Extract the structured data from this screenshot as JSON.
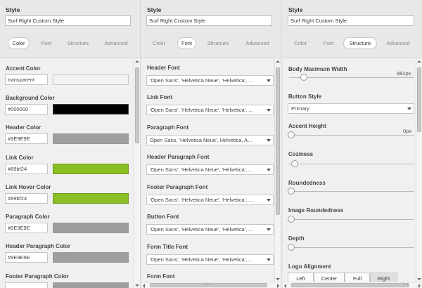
{
  "panels": [
    {
      "style_label": "Style",
      "style_value": "Surf Right Custom Style",
      "tabs": [
        "Color",
        "Font",
        "Structure",
        "Advanced"
      ],
      "active_tab": "Color",
      "color_fields": [
        {
          "label": "Accent Color",
          "value": "transparent",
          "swatch": "#f2f2f2"
        },
        {
          "label": "Background Color",
          "value": "#000000",
          "swatch": "#000000"
        },
        {
          "label": "Header Color",
          "value": "#9E9E9E",
          "swatch": "#9e9e9e"
        },
        {
          "label": "Link Color",
          "value": "#89bf24",
          "swatch": "#89bf24"
        },
        {
          "label": "Link Hover Color",
          "value": "#89bf24",
          "swatch": "#89bf24"
        },
        {
          "label": "Paragraph Color",
          "value": "#9E9E9E",
          "swatch": "#9e9e9e"
        },
        {
          "label": "Header Paragraph Color",
          "value": "#9E9E9E",
          "swatch": "#9e9e9e"
        },
        {
          "label": "Footer Paragraph Color",
          "value": "",
          "swatch": "#9e9e9e"
        }
      ]
    },
    {
      "style_label": "Style",
      "style_value": "Surf Right Custom Style",
      "tabs": [
        "Color",
        "Font",
        "Structure",
        "Advanced"
      ],
      "active_tab": "Font",
      "font_fields": [
        {
          "label": "Header Font",
          "value": "'Open Sans', 'Helvetica Neue', 'Helvetica', ..."
        },
        {
          "label": "Link Font",
          "value": "'Open Sans', 'Helvetica Neue', 'Helvetica', ..."
        },
        {
          "label": "Paragraph Font",
          "value": "Open Sans, 'Helvetica Neue', Helvetica, A..."
        },
        {
          "label": "Header Paragraph Font",
          "value": "'Open Sans', 'Helvetica Neue', 'Helvetica', ..."
        },
        {
          "label": "Footer Paragraph Font",
          "value": "'Open Sans', 'Helvetica Neue', 'Helvetica', ..."
        },
        {
          "label": "Button Font",
          "value": "'Open Sans', 'Helvetica Neue', 'Helvetica', ..."
        },
        {
          "label": "Form Title Font",
          "value": "'Open Sans', 'Helvetica Neue', 'Helvetica', ..."
        },
        {
          "label": "Form Font",
          "value": ""
        }
      ]
    },
    {
      "style_label": "Style",
      "style_value": "Surf Right Custom Style",
      "tabs": [
        "Color",
        "Font",
        "Structure",
        "Advanced"
      ],
      "active_tab": "Structure",
      "body_max_width": {
        "label": "Body Maximum Width",
        "value": "982px",
        "level": 0.1
      },
      "button_style": {
        "label": "Button Style",
        "value": "Primary"
      },
      "accent_height": {
        "label": "Accent Height",
        "value": "0px",
        "level": 0.0
      },
      "coziness": {
        "label": "Coziness",
        "level": 0.03
      },
      "roundedness": {
        "label": "Roundedness",
        "level": 0.0
      },
      "image_roundedness": {
        "label": "Image Roundedness",
        "level": 0.0
      },
      "depth": {
        "label": "Depth",
        "level": 0.0
      },
      "logo_alignment": {
        "label": "Logo Alignment",
        "options": [
          "Left",
          "Center",
          "Full",
          "Right"
        ],
        "selected": "Right"
      }
    }
  ]
}
